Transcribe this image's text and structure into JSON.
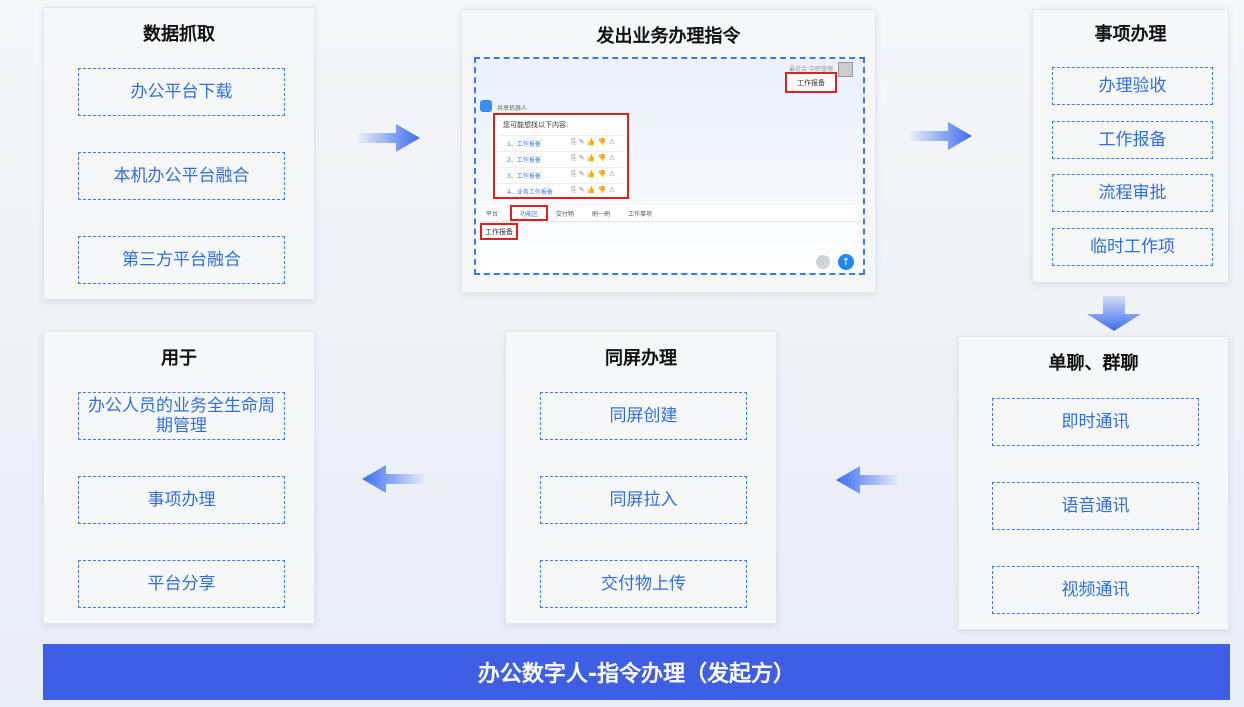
{
  "top_left": {
    "title": "数据抓取",
    "items": [
      "办公平台下载",
      "本机办公平台融合",
      "第三方平台融合"
    ]
  },
  "top_center": {
    "title": "发出业务办理指令",
    "mock": {
      "top_user_label": "最近会  中职管理",
      "top_request": "工作报备",
      "bot_name": "共享机器人",
      "prompt": "您可能想找以下内容:",
      "rows": [
        "1、工作报备",
        "2、工作报备",
        "3、工作报备",
        "4、业务工作报备"
      ],
      "row_icons": "⎘ ✎ 👍 👎 ⚠",
      "toolbar": [
        "平台",
        "功能区",
        "交付物",
        "刷一刷",
        "工作事项"
      ],
      "input_text": "工作报备"
    }
  },
  "top_right": {
    "title": "事项办理",
    "items": [
      "办理验收",
      "工作报备",
      "流程审批",
      "临时工作项"
    ]
  },
  "bottom_right": {
    "title": "单聊、群聊",
    "items": [
      "即时通讯",
      "语音通讯",
      "视频通讯"
    ]
  },
  "bottom_center": {
    "title": "同屏办理",
    "items": [
      "同屏创建",
      "同屏拉入",
      "交付物上传"
    ]
  },
  "bottom_left": {
    "title": "用于",
    "items": [
      "办公人员的业务全生命周期管理",
      "事项办理",
      "平台分享"
    ]
  },
  "banner": {
    "text": "办公数字人-指令办理（发起方）"
  },
  "colors": {
    "accent": "#3b7ae8",
    "banner": "#3f5ee6",
    "highlight_red": "#e02020",
    "arrow": "#3a6df0"
  },
  "icons": {
    "flow_arrow": "arrow-icon",
    "bot": "bot-icon",
    "avatar": "avatar-icon",
    "mic": "mic-icon",
    "send": "send-icon"
  }
}
